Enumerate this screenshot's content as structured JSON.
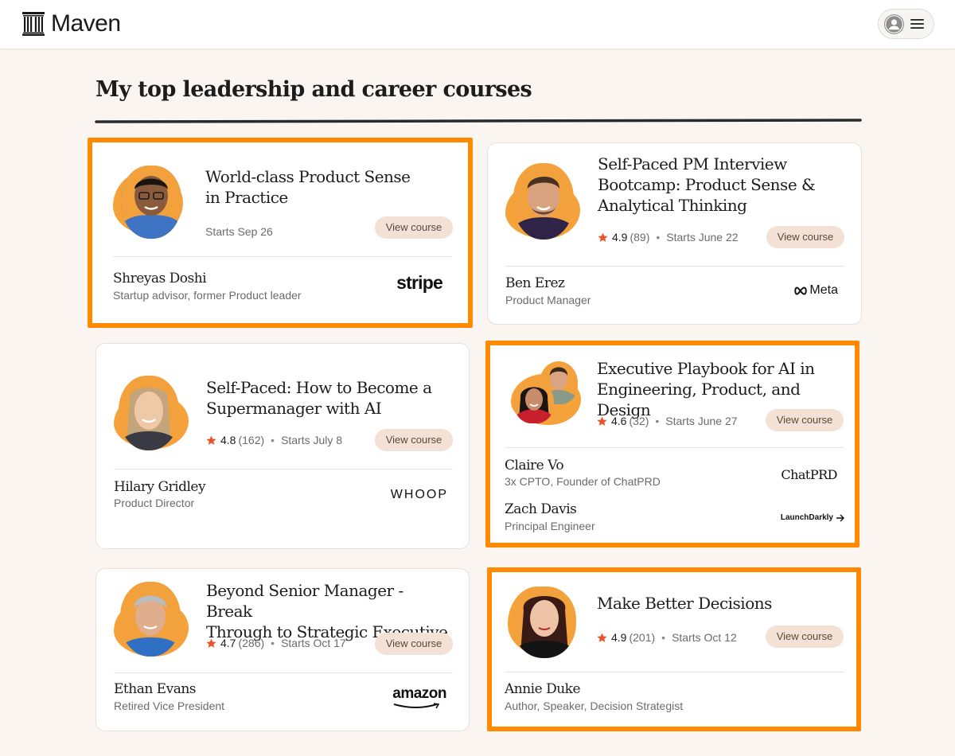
{
  "brand": {
    "name": "Maven"
  },
  "page": {
    "title": "My top leadership and career courses"
  },
  "common": {
    "view_label": "View course",
    "bullet": "•"
  },
  "colors": {
    "accent": "#ff8a00",
    "blob": "#f5a23a",
    "star": "#e8542a",
    "button_bg": "#f2e1d4"
  },
  "courses": [
    {
      "title_lines": [
        "World-class Product Sense",
        "in Practice"
      ],
      "rating": "",
      "count": "",
      "starts": "Starts Sep 26",
      "instructors": [
        {
          "name": "Shreyas Doshi",
          "role": "Startup advisor, former Product leader",
          "company": "stripe"
        }
      ],
      "highlighted": true
    },
    {
      "title_lines": [
        "Self-Paced PM Interview",
        "Bootcamp: Product Sense &",
        "Analytical Thinking"
      ],
      "rating": "4.9",
      "count": "(89)",
      "starts": "Starts June 22",
      "instructors": [
        {
          "name": "Ben Erez",
          "role": "Product Manager",
          "company": "Meta"
        }
      ],
      "highlighted": false
    },
    {
      "title_lines": [
        "Self-Paced: How to Become a",
        "Supermanager with AI"
      ],
      "rating": "4.8",
      "count": "(162)",
      "starts": "Starts July 8",
      "instructors": [
        {
          "name": "Hilary Gridley",
          "role": "Product Director",
          "company": "WHOOP"
        }
      ],
      "highlighted": false
    },
    {
      "title_lines": [
        "Executive Playbook for AI in",
        "Engineering, Product, and Design"
      ],
      "rating": "4.6",
      "count": "(32)",
      "starts": "Starts June 27",
      "instructors": [
        {
          "name": "Claire Vo",
          "role": "3x CPTO, Founder of ChatPRD",
          "company": "ChatPRD"
        },
        {
          "name": "Zach Davis",
          "role": "Principal Engineer",
          "company": "LaunchDarkly"
        }
      ],
      "highlighted": true
    },
    {
      "title_lines": [
        "Beyond Senior Manager - Break",
        "Through to Strategic Executive"
      ],
      "rating": "4.7",
      "count": "(286)",
      "starts": "Starts Oct 17",
      "instructors": [
        {
          "name": "Ethan Evans",
          "role": "Retired Vice President",
          "company": "amazon"
        }
      ],
      "highlighted": false
    },
    {
      "title_lines": [
        "Make Better Decisions"
      ],
      "rating": "4.9",
      "count": "(201)",
      "starts": "Starts Oct 12",
      "instructors": [
        {
          "name": "Annie Duke",
          "role": "Author, Speaker, Decision Strategist",
          "company": ""
        }
      ],
      "highlighted": true
    }
  ]
}
